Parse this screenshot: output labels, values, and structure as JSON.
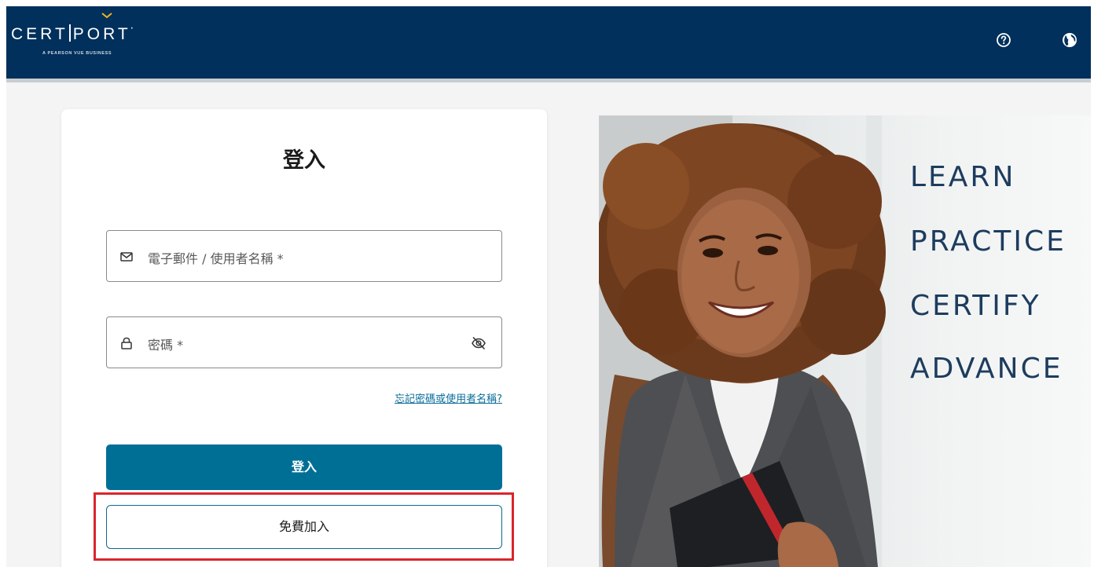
{
  "header": {
    "logo_text": "CERTIPORT",
    "logo_tagline": "A PEARSON VUE BUSINESS",
    "icons": [
      "help-circle-icon",
      "globe-icon"
    ]
  },
  "login": {
    "title": "登入",
    "email_placeholder": "電子郵件 / 使用者名稱 *",
    "password_placeholder": "密碼 *",
    "forgot_link": "忘記密碼或使用者名稱?",
    "login_button": "登入",
    "join_button": "免費加入"
  },
  "hero": {
    "lines": [
      "LEARN",
      "PRACTICE",
      "CERTIFY",
      "ADVANCE"
    ]
  },
  "colors": {
    "header_bg": "#00305b",
    "primary_button": "#006f96",
    "link": "#0a6e99",
    "highlight_border": "#d9262c",
    "hero_text": "#1d3c5e"
  }
}
